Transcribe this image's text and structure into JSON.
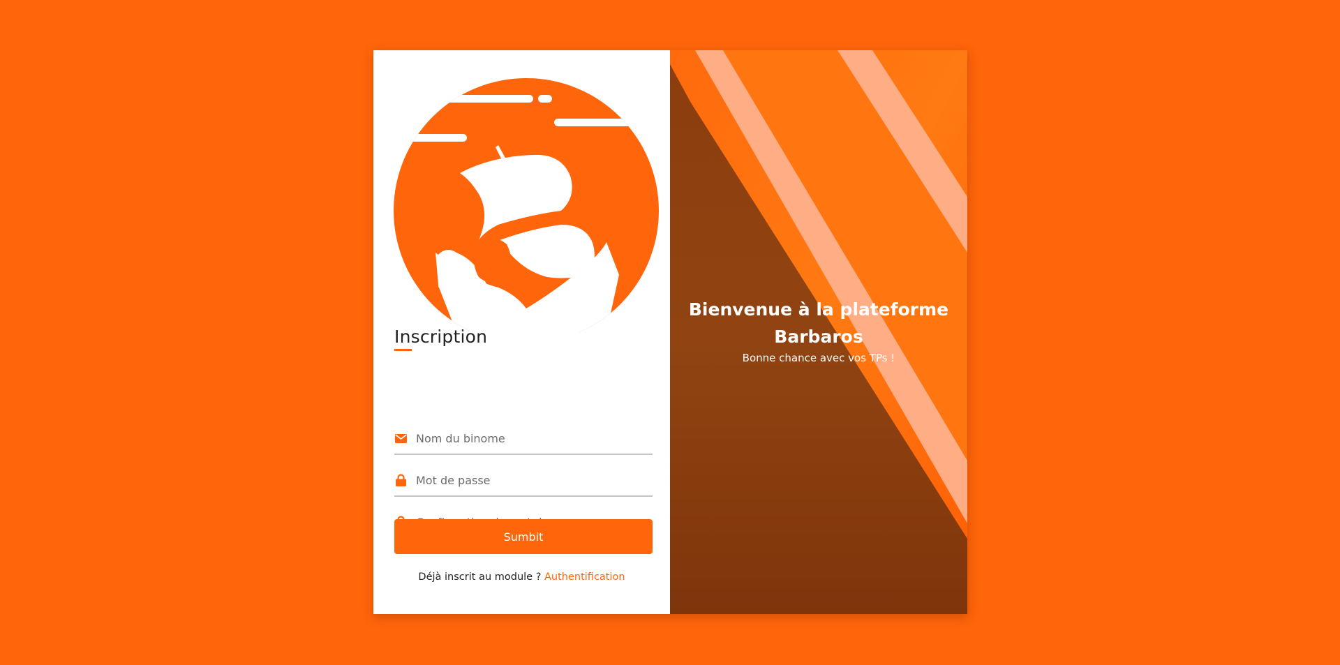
{
  "register_form": {
    "title": "Inscription",
    "fields": [
      {
        "icon": "envelope-icon",
        "placeholder": "Nom du binome",
        "value": ""
      },
      {
        "icon": "lock-icon",
        "placeholder": "Mot de passe",
        "value": ""
      },
      {
        "icon": "lock-icon",
        "placeholder": "Confirmation de mot de passe",
        "value": ""
      }
    ],
    "submit_label": "Sumbit",
    "already_registered_text": "Déjà inscrit au module ?",
    "login_link": "Authentification"
  },
  "welcome_panel": {
    "heading": "Bienvenue à la plateforme Barbaros",
    "subtitle": "Bonne chance avec vos TPs !"
  },
  "colors": {
    "accent": "#ff650a",
    "panel_dark": "#8a3a0c",
    "stripe": "#ffad85",
    "text": "#222222"
  }
}
